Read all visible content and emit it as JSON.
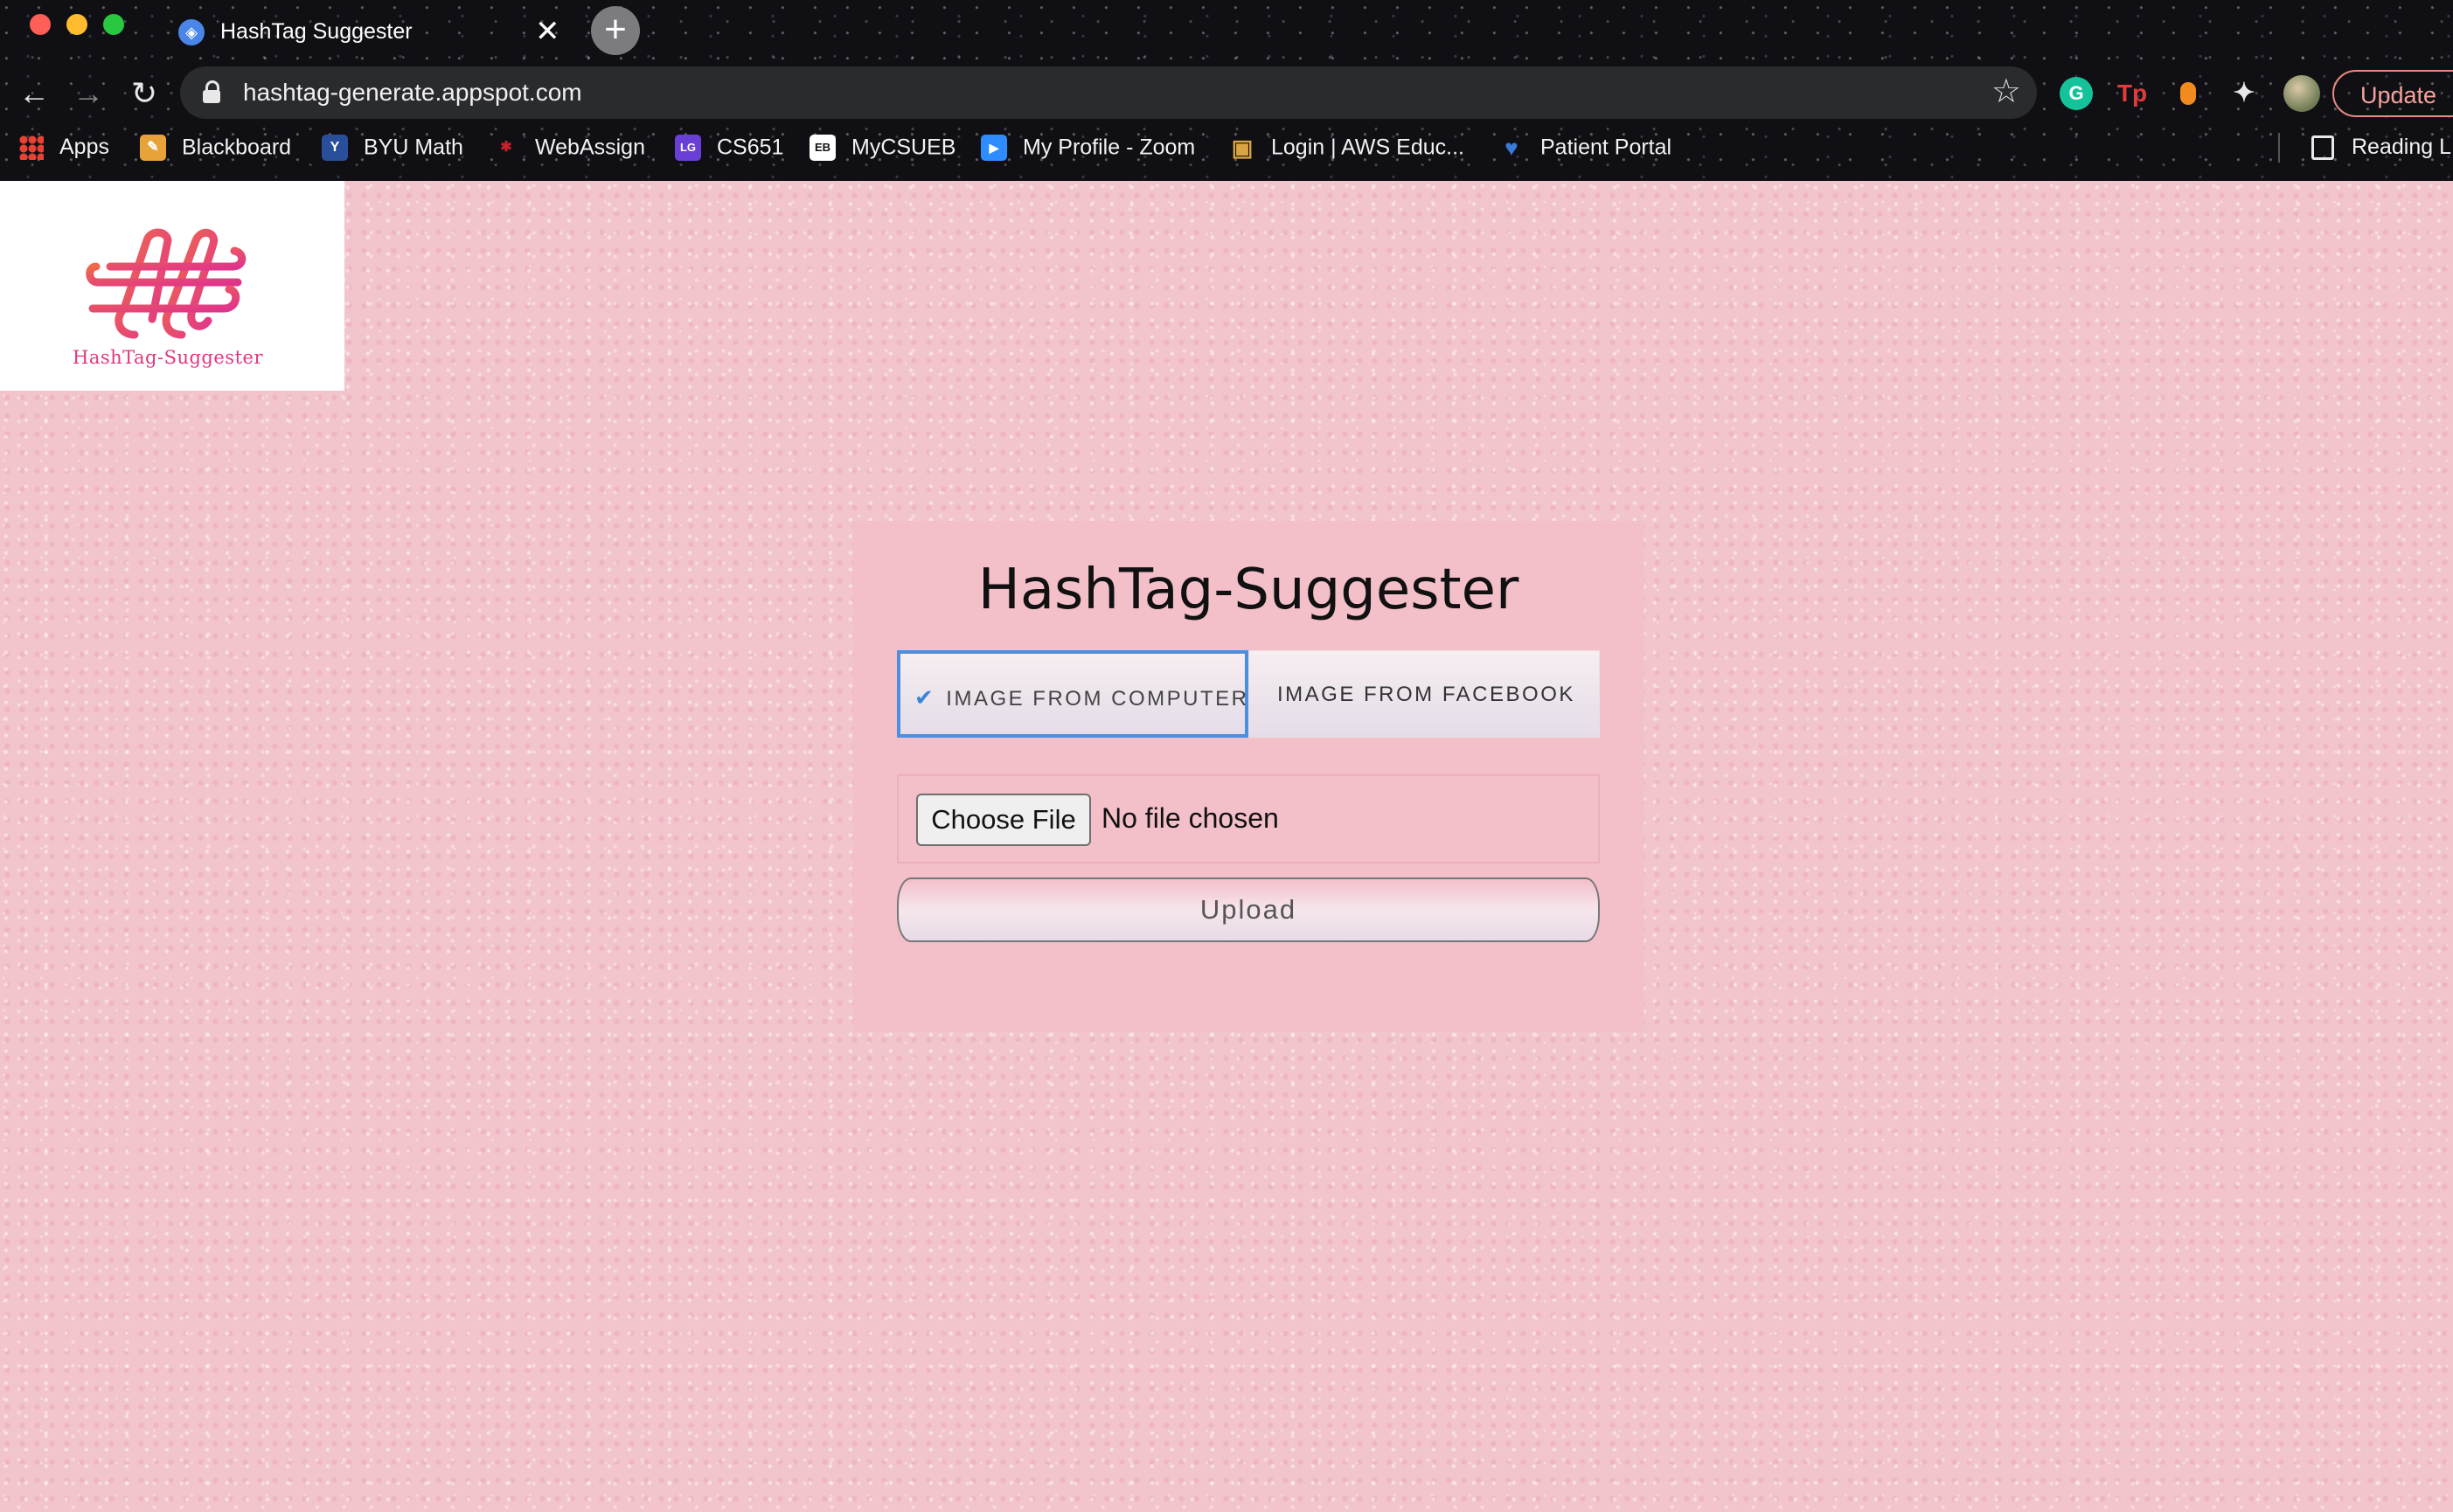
{
  "browser": {
    "tab": {
      "title": "HashTag Suggester",
      "favicon": "compass-icon",
      "close_glyph": "✕"
    },
    "new_tab_glyph": "+",
    "nav": {
      "back": "←",
      "forward": "→",
      "reload": "↻"
    },
    "address_bar": {
      "url": "hashtag-generate.appspot.com"
    },
    "bookmark_star": "☆",
    "extensions": {
      "grammarly": "G",
      "tp": "Tp",
      "puzzle": "✦"
    },
    "update_label": "Update",
    "bookmarks": [
      {
        "label": "Apps"
      },
      {
        "label": "Blackboard",
        "icon_text": "✎",
        "color": "#e8a23a"
      },
      {
        "label": "BYU Math",
        "icon_text": "Y",
        "color": "#2a4f9a"
      },
      {
        "label": "WebAssign",
        "icon_text": "✱",
        "color": "#c4232d"
      },
      {
        "label": "CS651",
        "icon_text": "LG",
        "color": "#6a3fd6"
      },
      {
        "label": "MyCSUEB",
        "icon_text": "EB",
        "color": "#ffffff"
      },
      {
        "label": "My Profile - Zoom",
        "icon_text": "▶",
        "color": "#2d8cff"
      },
      {
        "label": "Login | AWS Educ...",
        "icon_text": "▣",
        "color": "#d9a441"
      },
      {
        "label": "Patient Portal",
        "icon_text": "♥",
        "color": "#3b7bd8"
      },
      {
        "label": "Reading L"
      }
    ]
  },
  "page": {
    "logo": {
      "text": "HashTag-Suggester",
      "color": "#e2367f"
    },
    "title": "HashTag-Suggester",
    "tabs": [
      {
        "label": "IMAGE FROM COMPUTER",
        "selected": true,
        "check_glyph": "✔"
      },
      {
        "label": "IMAGE FROM FACEBOOK",
        "selected": false
      }
    ],
    "file_input": {
      "button_label": "Choose File",
      "status": "No file chosen"
    },
    "upload_label": "Upload",
    "colors": {
      "background": "#f2c4cc",
      "panel": "#f3bfc9",
      "accent": "#4a8fe0"
    }
  }
}
